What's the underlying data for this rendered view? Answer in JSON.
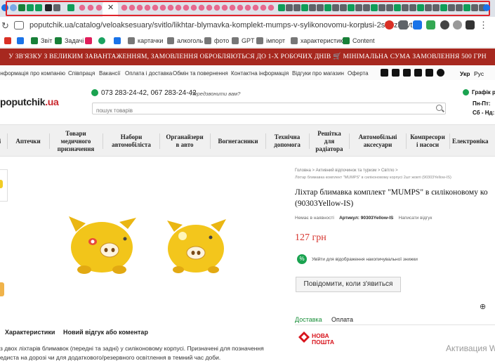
{
  "browser": {
    "url": "poputchik.ua/catalog/veloaksesuary/svitlo/likhtar-blymavka-komplekt-mumps-v-sylikonovomu-korpusi-2sht-zhovti",
    "bookmarks": [
      "Звіт",
      "Задачі",
      "картачки",
      "алкоголь",
      "фото",
      "GPT",
      "імпорт",
      "характеристики",
      "Content"
    ]
  },
  "site": {
    "announcement": "У ЗВ'ЯЗКУ З ВЕЛИКИМ ЗАВАНТАЖЕННЯМ, ЗАМОВЛЕННЯ ОБРОБЛЯЮТЬСЯ ДО 1-Х РОБОЧИХ ДНІВ 🛒 МІНІМАЛЬНА СУМА ЗАМОВЛЕННЯ 500 ГРН",
    "info_nav": [
      "Інформація про компанію",
      "Співпраця",
      "Вакансії",
      "Оплата і доставка",
      "Обмін та повернення",
      "Контактна інформація",
      "Відгуки про магазин",
      "Оферта"
    ],
    "langs": [
      "Укр",
      "Рус"
    ],
    "logo_main": "poputchik",
    "logo_tld": ".ua",
    "phones": "073 283-24-42,   067 283-24-42",
    "callback": "Передзвонити вам?",
    "search_placeholder": "пошук товарів",
    "schedule_title": "Графік ро",
    "schedule_lines": [
      "Пн-Пт:",
      "Сб - Нд:"
    ]
  },
  "categories": [
    {
      "label": "Аптечки"
    },
    {
      "label": "Товари\nмедичного\nпризначення"
    },
    {
      "label": "Набори\nавтомобіліста"
    },
    {
      "label": "Органайзери\nв авто"
    },
    {
      "label": "Вогнегасники"
    },
    {
      "label": "Технічна\nдопомога"
    },
    {
      "label": "Решітка\nдля\nрадіатора"
    },
    {
      "label": "Автомобільні\nаксесуари"
    },
    {
      "label": "Компресори\nі насоси"
    },
    {
      "label": "Електроніка"
    }
  ],
  "product": {
    "breadcrumb": "Головна  >  Активний відпочинок та туризм  >  Світло  >",
    "breadcrumb_sub": "Ліхтар блимавка комплект \"MUMPS\" в силіконовому корпусі 2шт жовті (90303Yellow-IS)",
    "title_line1": "Ліхтар блимавка комплект \"MUMPS\" в силіконовому ко",
    "title_line2": "(90303Yellow-IS)",
    "stock": "Немає в наявності",
    "article_label": "Артикул:",
    "article": "90303Yellow-IS",
    "review_link": "Написати відгук",
    "price": "127 грн",
    "discount_text": "Увійти для відображення накопичувальної знижки",
    "notify_button": "Повідомити, коли з'явиться",
    "delivery_tab": "Доставка",
    "payment_tab": "Оплата",
    "np_line1": "НОВА",
    "np_line2": "ПОШТА"
  },
  "bottom": {
    "tab_specs": "Характеристики",
    "tab_review": "Новий відгук або коментар",
    "desc1": "з двох ліхтарів блимавок (передні та задні) у силіконовому корпусі. Призначені для позначення",
    "desc2": "едиста на дорозі чи для додаткового/резервного освітлення в темний час доби."
  },
  "overlay": {
    "watermark": "Активация W"
  },
  "colors": {
    "announce_bg": "#a7281f",
    "price": "#d6332d",
    "accent_green": "#1aa350",
    "tab_highlight": "#e0242c"
  }
}
